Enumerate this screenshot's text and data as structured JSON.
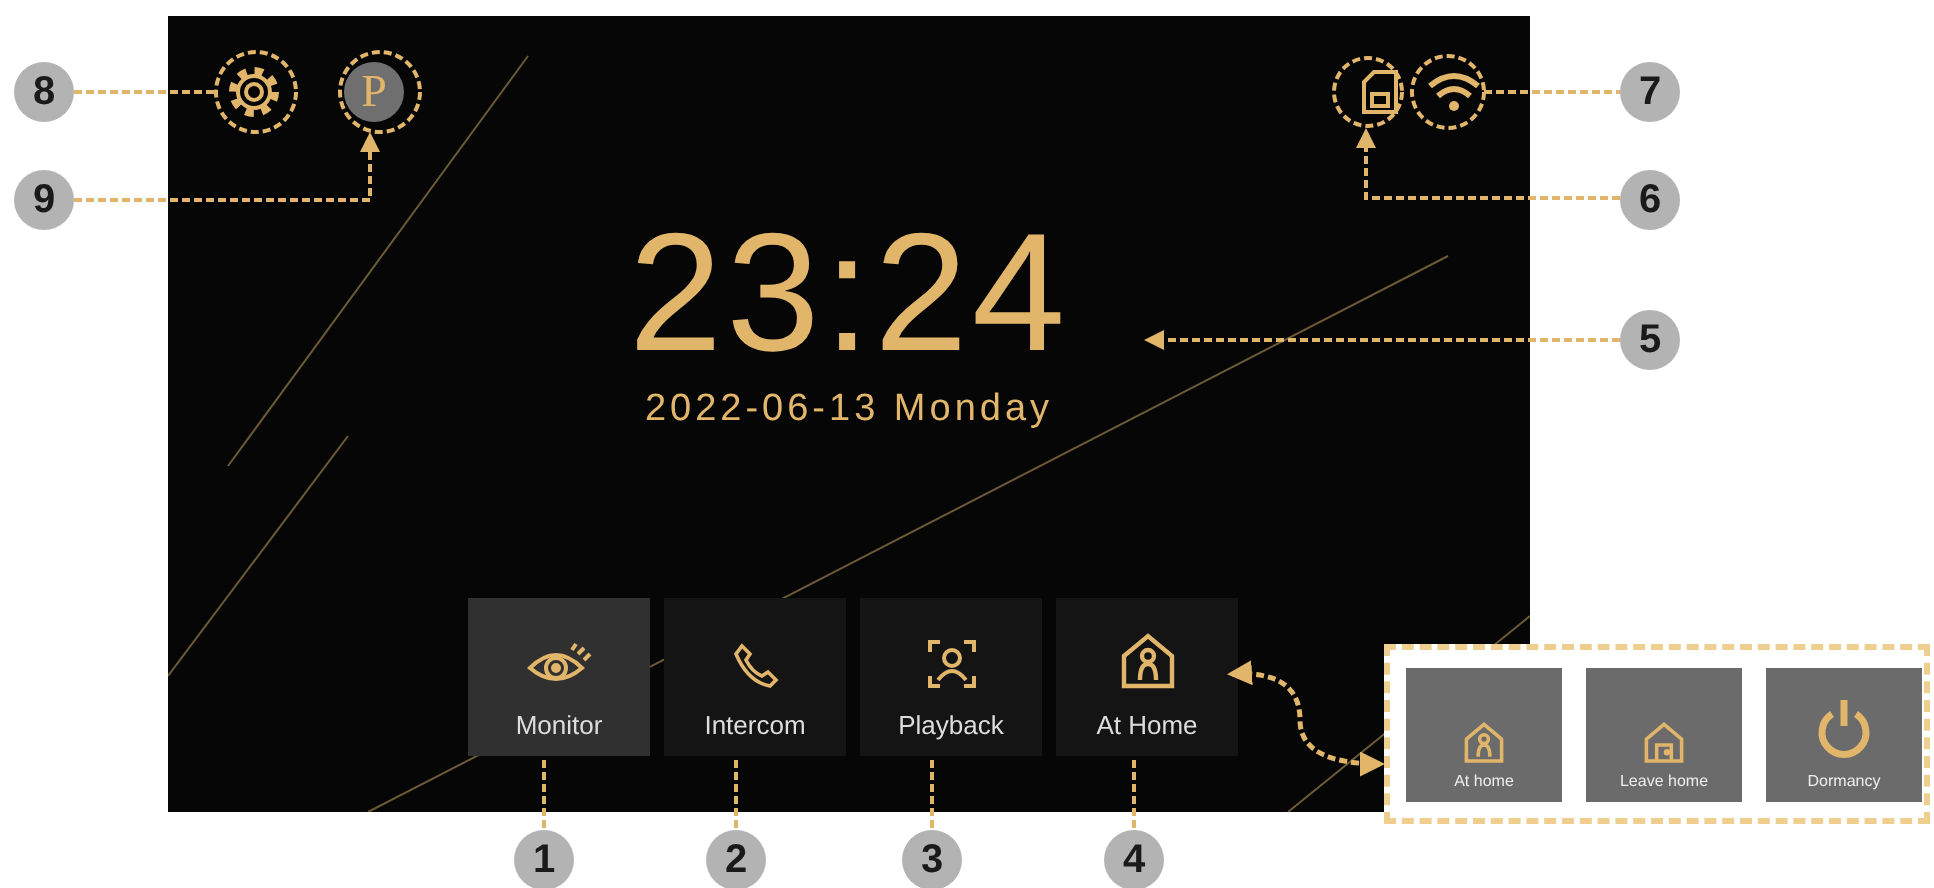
{
  "screen": {
    "profile_initial": "P",
    "time": "23:24",
    "date": "2022-06-13 Monday",
    "buttons": [
      {
        "label": "Monitor",
        "selected": true
      },
      {
        "label": "Intercom",
        "selected": false
      },
      {
        "label": "Playback",
        "selected": false
      },
      {
        "label": "At Home",
        "selected": false
      }
    ]
  },
  "mode_options": [
    {
      "label": "At home"
    },
    {
      "label": "Leave home"
    },
    {
      "label": "Dormancy"
    }
  ],
  "callouts": [
    "8",
    "7",
    "9",
    "6",
    "5",
    "1",
    "2",
    "3",
    "4"
  ]
}
